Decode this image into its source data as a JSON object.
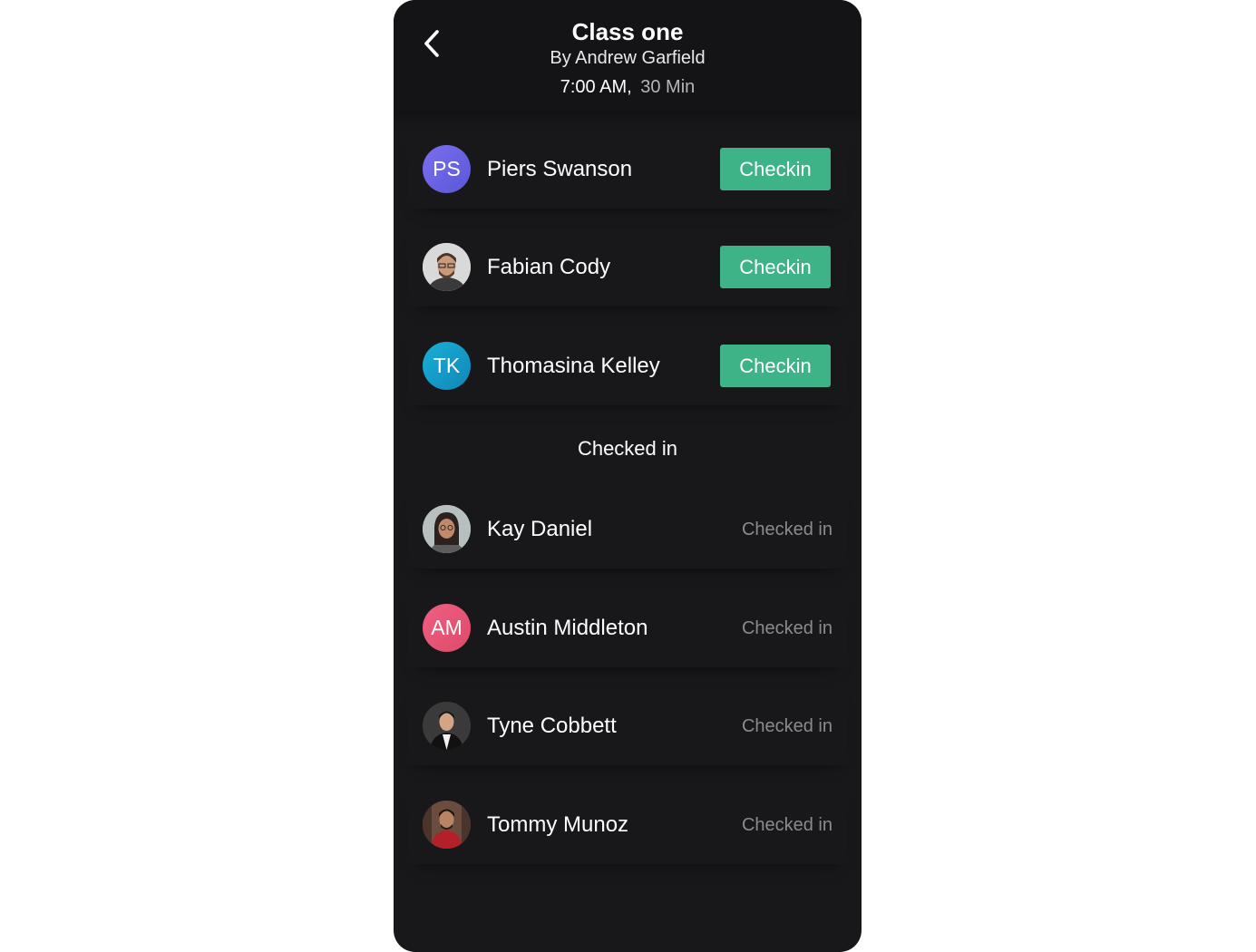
{
  "header": {
    "title": "Class one",
    "subtitle": "By Andrew Garfield",
    "time": "7:00 AM,",
    "duration": "30 Min",
    "back_icon": "chevron-left-icon"
  },
  "pending": [
    {
      "initials": "PS",
      "name": "Piers Swanson",
      "action": "Checkin"
    },
    {
      "initials": "",
      "name": "Fabian Cody",
      "action": "Checkin"
    },
    {
      "initials": "TK",
      "name": "Thomasina Kelley",
      "action": "Checkin"
    }
  ],
  "section_title": "Checked in",
  "checked_in": [
    {
      "initials": "",
      "name": "Kay Daniel",
      "status": "Checked in"
    },
    {
      "initials": "AM",
      "name": "Austin Middleton",
      "status": "Checked in"
    },
    {
      "initials": "",
      "name": "Tyne Cobbett",
      "status": "Checked in"
    },
    {
      "initials": "",
      "name": "Tommy Munoz",
      "status": "Checked in"
    }
  ],
  "colors": {
    "background": "#18181b",
    "header": "#141417",
    "accent_green": "#3db387",
    "avatar_ps": "#6b63e0",
    "avatar_tk": "#1a9fcf",
    "avatar_am": "#e55476",
    "muted_text": "#8b8b8f"
  }
}
